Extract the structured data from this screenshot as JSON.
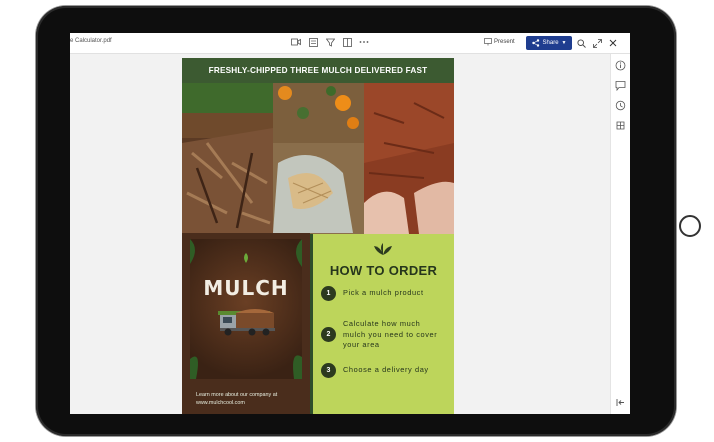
{
  "app": {
    "doc_title": "e Calculator.pdf",
    "present_label": "Present",
    "share_label": "Share",
    "toolbar_icons": [
      "video-icon",
      "page-icon",
      "filter-icon",
      "panel-icon",
      "more-icon"
    ],
    "right_rail_icons": [
      "info-icon",
      "comment-icon",
      "history-icon",
      "addons-icon"
    ]
  },
  "flyer": {
    "banner": "FRESHLY-CHIPPED THREE MULCH DELIVERED FAST",
    "logo_text": "MULCH",
    "footer_line1": "Learn more about our company at",
    "footer_line2": "www.mulchcool.com",
    "order_title": "HOW TO ORDER",
    "steps": [
      {
        "num": "1",
        "text": "Pick a mulch product"
      },
      {
        "num": "2",
        "text": "Calculate how much mulch you need to cover your area"
      },
      {
        "num": "3",
        "text": "Choose a delivery day"
      }
    ]
  },
  "colors": {
    "banner_green": "#3c5a31",
    "order_panel": "#bdd55b",
    "share_blue": "#1f3d8f"
  }
}
